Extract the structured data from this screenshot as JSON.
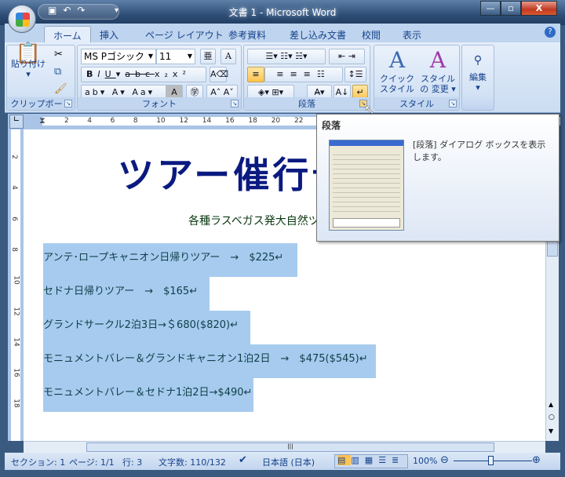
{
  "window": {
    "title": "文書 1 - Microsoft Word"
  },
  "tabs": [
    {
      "label": "ホーム",
      "active": true
    },
    {
      "label": "挿入"
    },
    {
      "label": "ページ レイアウト"
    },
    {
      "label": "参考資料"
    },
    {
      "label": "差し込み文書"
    },
    {
      "label": "校閲"
    },
    {
      "label": "表示"
    }
  ],
  "ribbon": {
    "clipboard": {
      "label": "クリップボード",
      "paste": "貼り付け"
    },
    "font": {
      "label": "フォント",
      "font_name": "MS Pゴシック",
      "font_size": "11"
    },
    "paragraph": {
      "label": "段落"
    },
    "styles": {
      "label": "スタイル",
      "quick": "クイック スタイル",
      "change": "スタイルの 変更"
    },
    "editing": {
      "label": "編集"
    }
  },
  "ruler": {
    "h": [
      "2",
      "4",
      "6",
      "8",
      "10",
      "12",
      "14",
      "16",
      "18",
      "20",
      "22"
    ],
    "v": [
      "2",
      "4",
      "6",
      "8",
      "10",
      "12",
      "14",
      "16",
      "18"
    ]
  },
  "document": {
    "title": "ツアー催行予",
    "subtitle": "各種ラスベガス発大自然ツ",
    "lines": [
      "アンテ･ロープキャニオン日帰りツアー　→　$225↵",
      "セドナ日帰りツアー　→　$165↵",
      "グランドサークル2泊3日→＄680($820)↵",
      "モニュメントバレー＆グランドキャニオン1泊2日　→　$475($545)↵",
      "モニュメントバレー＆セドナ1泊2日→$490↵"
    ]
  },
  "tooltip": {
    "title": "段落",
    "description": "[段落] ダイアログ ボックスを表示します。"
  },
  "status": {
    "section": "セクション: 1",
    "page": "ページ: 1/1",
    "line": "行: 3",
    "chars": "文字数: 110/132",
    "language": "日本語 (日本)",
    "zoom": "100%"
  },
  "colors": {
    "title_text": "#0a1a80",
    "selection": "#a7cbef",
    "ribbon": "#d3e2f5"
  }
}
